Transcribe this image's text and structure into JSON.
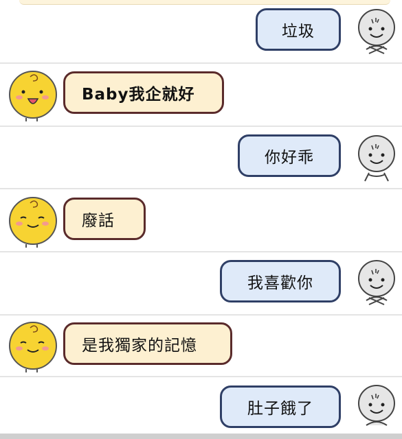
{
  "messages": [
    {
      "side": "user",
      "text": "垃圾"
    },
    {
      "side": "bot",
      "text": "Baby我企就好"
    },
    {
      "side": "user",
      "text": "你好乖"
    },
    {
      "side": "bot",
      "text": "廢話"
    },
    {
      "side": "user",
      "text": "我喜歡你"
    },
    {
      "side": "bot",
      "text": "是我獨家的記憶"
    },
    {
      "side": "user",
      "text": "肚子餓了"
    }
  ],
  "colors": {
    "user_bubble": "#dfeaf9",
    "user_border": "#2f3f66",
    "bot_bubble": "#fdf0d1",
    "bot_border": "#5a2b2b",
    "bot_avatar": "#f7d332",
    "user_avatar": "#e6e6e6"
  },
  "icons": {
    "user_avatar": "gray-smiley-avatar-icon",
    "bot_avatar": "yellow-chick-avatar-icon"
  }
}
